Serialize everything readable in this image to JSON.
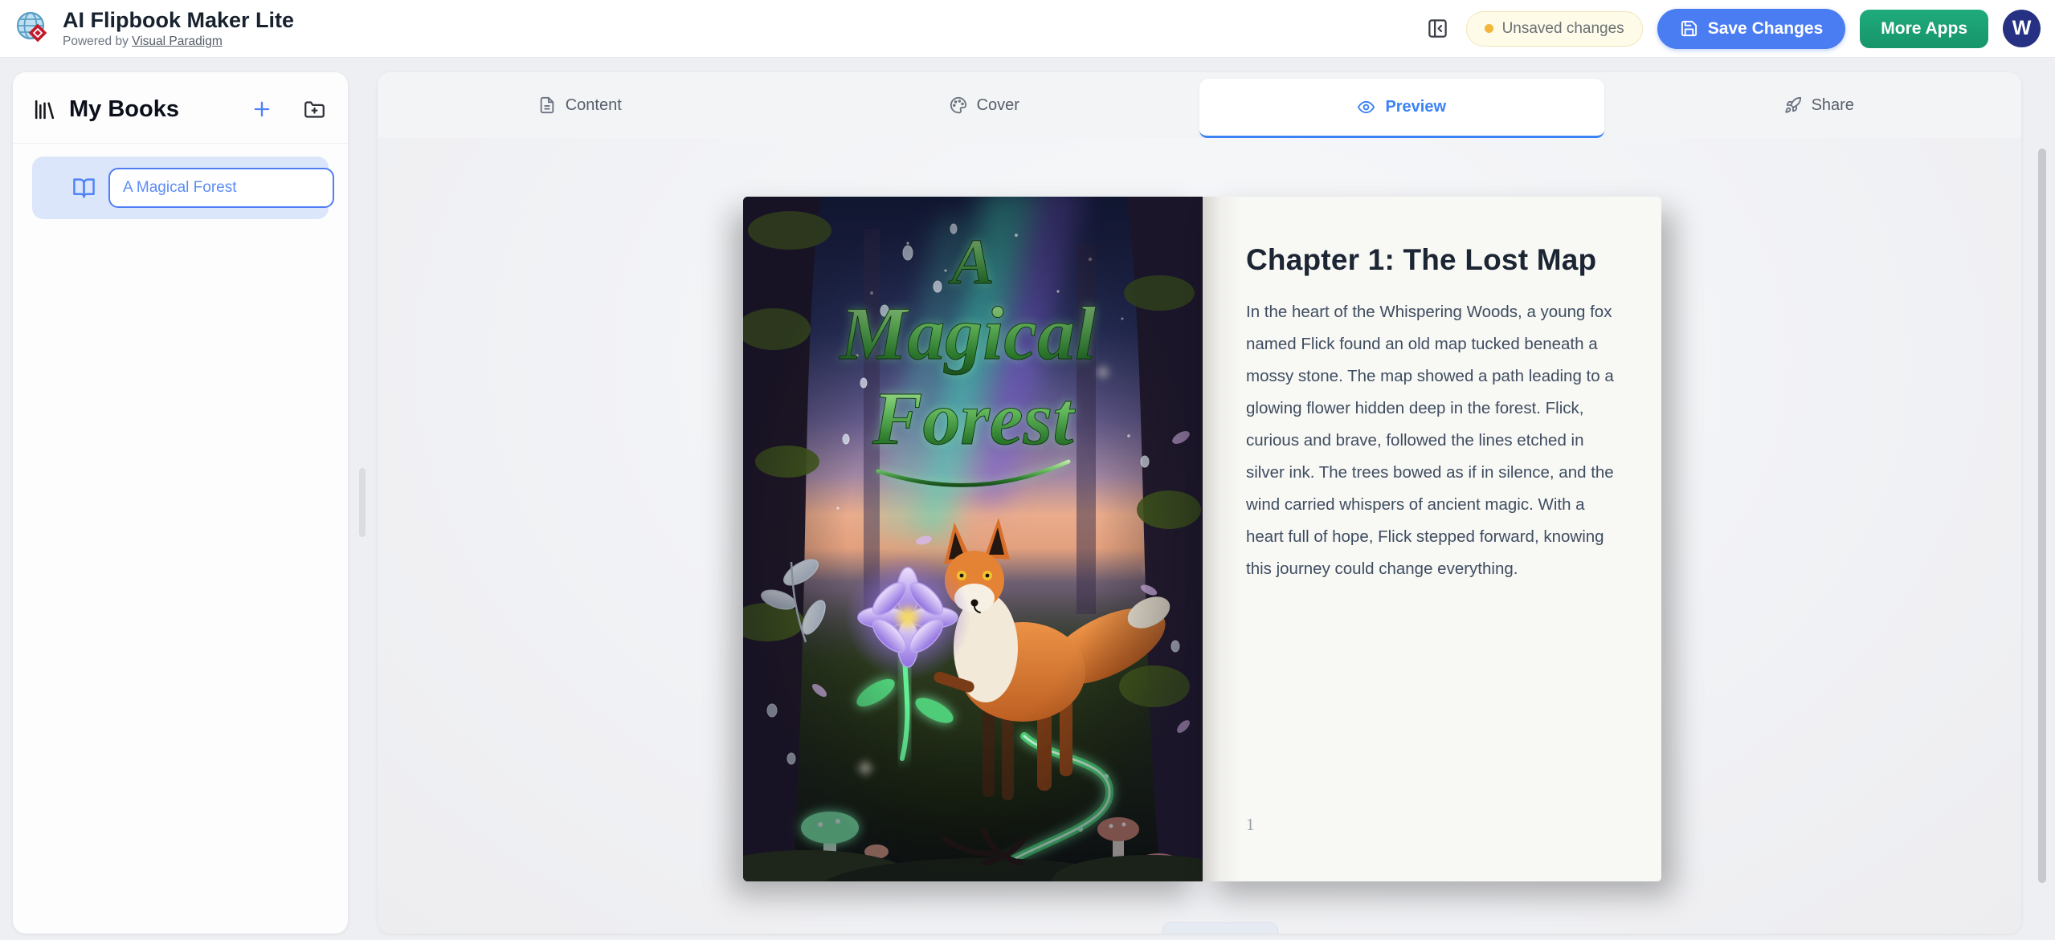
{
  "header": {
    "app_title": "AI Flipbook Maker Lite",
    "powered_by_prefix": "Powered by ",
    "powered_by_link": "Visual Paradigm",
    "unsaved_badge": "Unsaved changes",
    "save_button": "Save Changes",
    "more_apps_button": "More Apps",
    "avatar_initial": "W"
  },
  "sidebar": {
    "title": "My Books",
    "book_title_value": "A Magical Forest"
  },
  "tabs": {
    "content": "Content",
    "cover": "Cover",
    "preview": "Preview",
    "share": "Share"
  },
  "book": {
    "cover_title_line1": "A",
    "cover_title_line2": "Magical",
    "cover_title_line3": "Forest",
    "chapter_title": "Chapter 1: The Lost Map",
    "chapter_body": "In the heart of the Whispering Woods, a young fox named Flick found an old map tucked beneath a mossy stone. The map showed a path leading to a glowing flower hidden deep in the forest. Flick, curious and brave, followed the lines etched in silver ink. The trees bowed as if in silence, and the wind carried whispers of ancient magic. With a heart full of hope, Flick stepped forward, knowing this journey could change everything.",
    "page_number": "1"
  },
  "colors": {
    "accent_blue": "#3b82f6",
    "save_button_blue": "#4a7cf2",
    "more_apps_green": "#1aa377",
    "avatar_navy": "#263183",
    "unsaved_dot_amber": "#f2b63c",
    "selected_item_bg": "#dce6fb",
    "page_paper": "#f8f8f5"
  }
}
